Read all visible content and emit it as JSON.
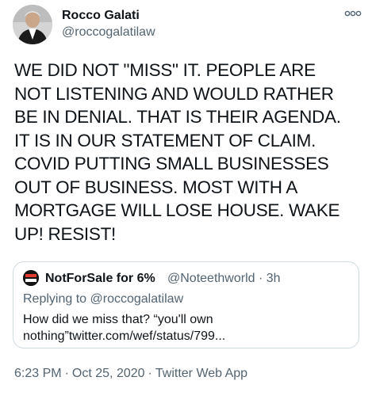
{
  "header": {
    "display_name": "Rocco Galati",
    "handle": "@roccogalatilaw"
  },
  "tweet": {
    "text": "WE DID NOT \"MISS\" IT. PEOPLE ARE\nNOT LISTENING AND WOULD RATHER\nBE IN DENIAL. THAT IS THEIR AGENDA.\nIT IS IN OUR STATEMENT OF CLAIM.\nCOVID PUTTING SMALL BUSINESSES\nOUT OF BUSINESS. MOST WITH A\nMORTGAGE WILL LOSE HOUSE. WAKE\nUP! RESIST!"
  },
  "quote": {
    "display_name": "NotForSale for 6%",
    "handle": "@Noteethworld",
    "separator": "·",
    "time": "3h",
    "replying_to": "Replying to @roccogalatilaw",
    "text": "How did we miss that? “you'll own nothing”twitter.com/wef/status/799...",
    "avatar_text": "NOT FOR SALE"
  },
  "footer": {
    "time": "6:23 PM",
    "date": "Oct 25, 2020",
    "separator": "·",
    "app": "Twitter Web App"
  },
  "icons": {
    "more": "more-options-icon"
  },
  "colors": {
    "text": "#0f1419",
    "secondary": "#536471",
    "border": "#cfd9de"
  }
}
